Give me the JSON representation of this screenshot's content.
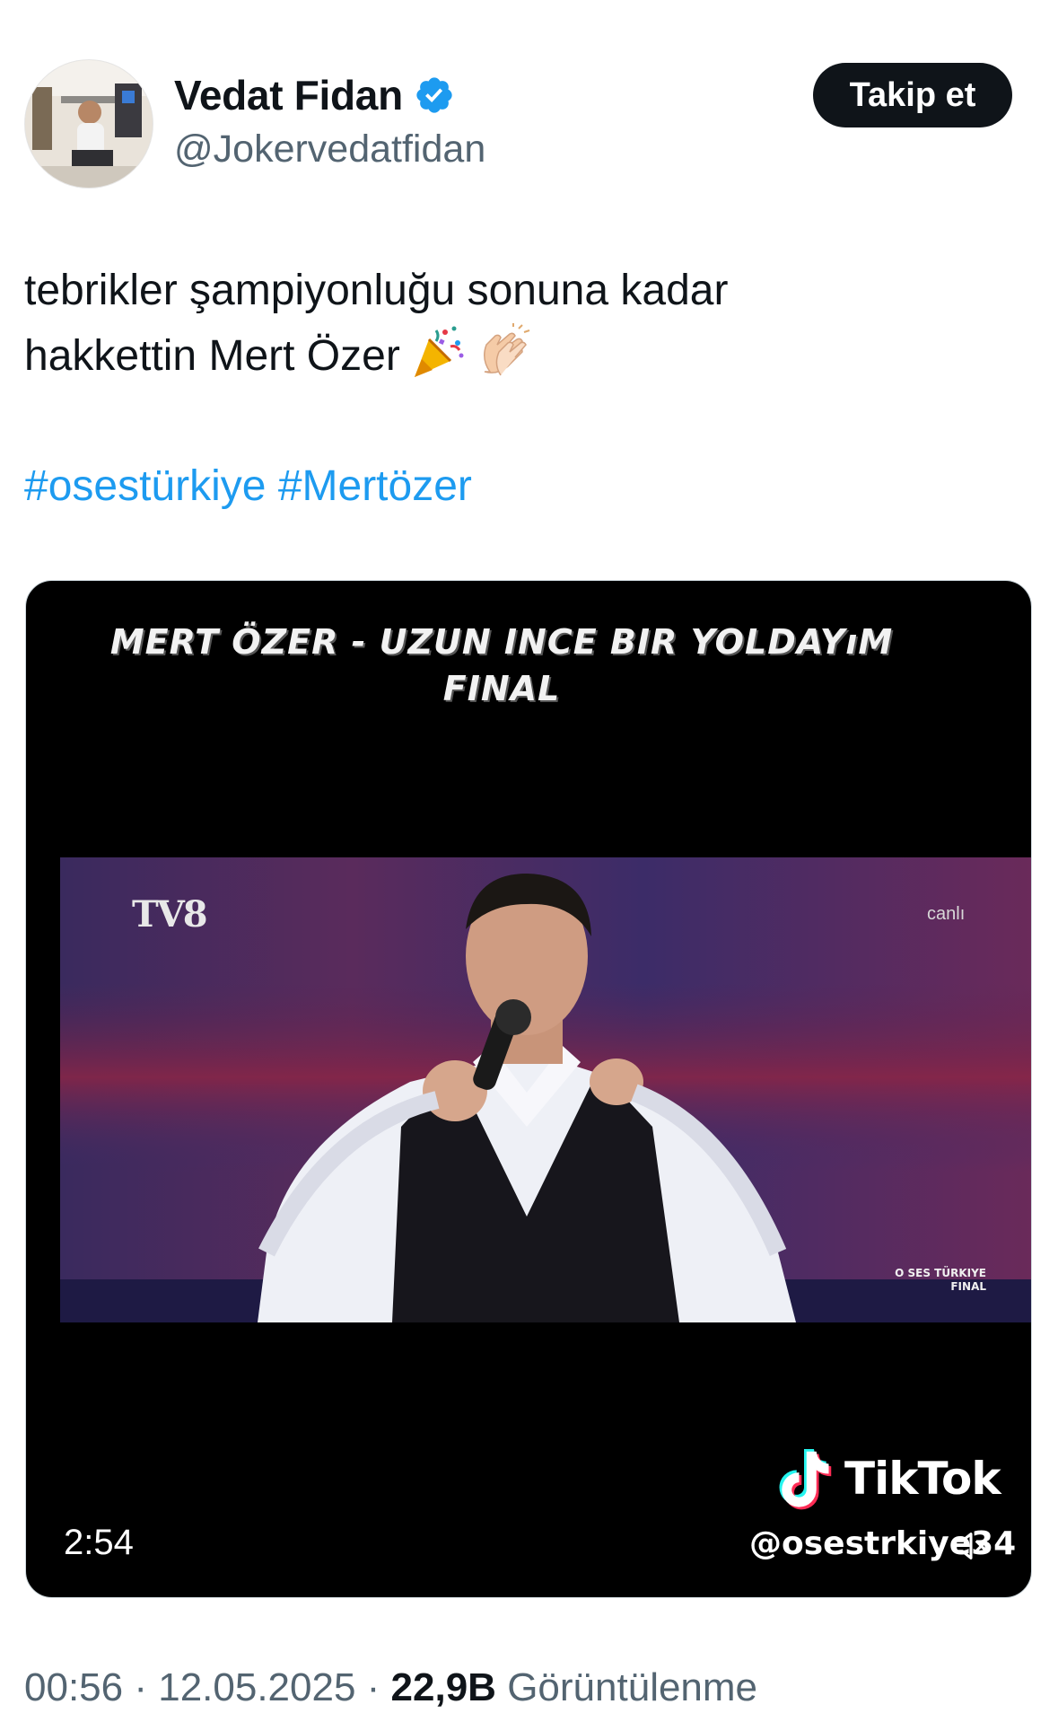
{
  "author": {
    "display_name": "Vedat Fidan",
    "handle": "@Jokervedatfidan",
    "verified": true,
    "verified_color": "#1d9bf0"
  },
  "follow_button": {
    "label": "Takip et"
  },
  "tweet": {
    "text_line1": "tebrikler şampiyonluğu sonuna kadar",
    "text_line2": "hakkettin Mert Özer",
    "emojis": [
      "party-popper",
      "clapping-hands"
    ],
    "hashtags": [
      "#osestürkiye",
      "#Mertözer"
    ]
  },
  "video": {
    "caption_line1": "MERT ÖZER - UZUN INCE BIR YOLDAYıM",
    "caption_line2": "FINAL",
    "channel_logo": "TV8",
    "live_label": "canlı",
    "show_logo_line1": "O SES TÜRKIYE",
    "show_logo_line2": "FINAL",
    "watermark_brand": "TikTok",
    "watermark_user": "@osestrkiye34",
    "duration": "2:54",
    "muted": true
  },
  "meta": {
    "time": "00:56",
    "separator": " · ",
    "date": "12.05.2025",
    "views_count": "22,9B",
    "views_label": "Görüntülenme"
  },
  "colors": {
    "link": "#1d9bf0",
    "text": "#0f1419",
    "secondary": "#536471",
    "button_bg": "#0f1419"
  }
}
